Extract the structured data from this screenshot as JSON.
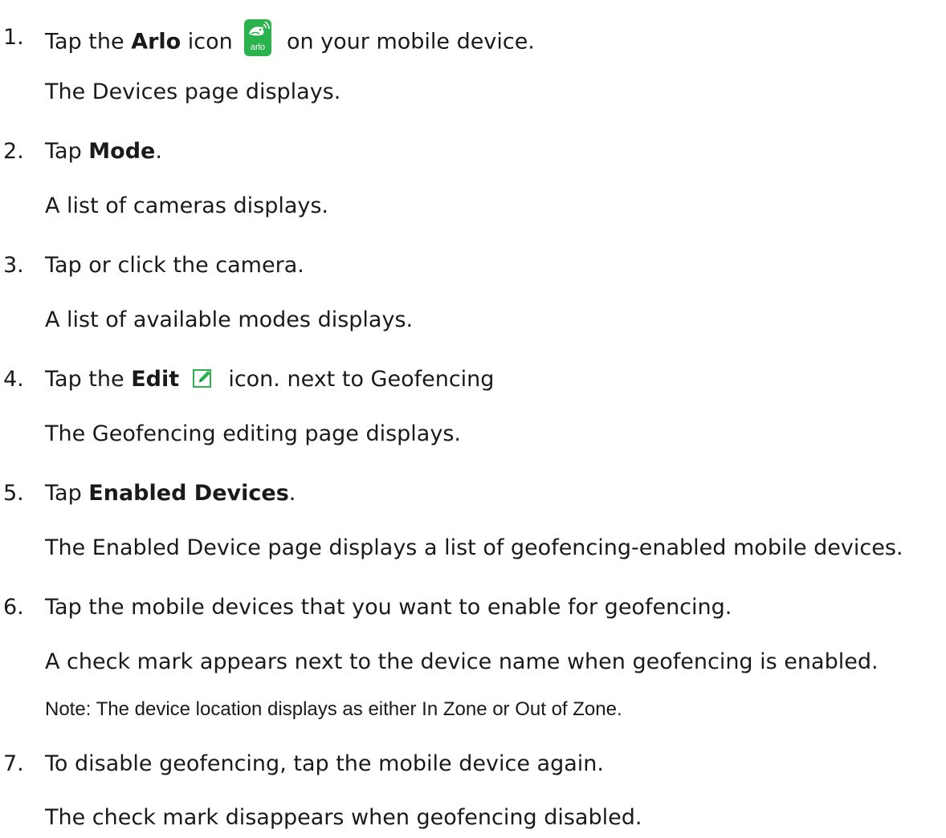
{
  "steps": [
    {
      "number": "1.",
      "pre": "Tap the ",
      "bold": "Arlo",
      "mid": " icon",
      "post": "on your mobile device.",
      "icon": "arlo-app-icon",
      "icon_text": "arlo",
      "icon_color": "#2bb24c",
      "detail": "The Devices page displays."
    },
    {
      "number": "2.",
      "pre": "Tap ",
      "bold": "Mode",
      "post": ".",
      "detail": "A list of cameras displays."
    },
    {
      "number": "3.",
      "text": "Tap or click the camera.",
      "detail": "A list of available modes displays."
    },
    {
      "number": "4.",
      "pre": "Tap the ",
      "bold": "Edit",
      "post": "icon. next to Geofencing",
      "icon": "edit-pencil-icon",
      "icon_color": "#2bb24c",
      "detail": "The Geofencing editing page displays."
    },
    {
      "number": "5.",
      "pre": "Tap ",
      "bold": "Enabled Devices",
      "post": ".",
      "detail": "The Enabled Device page displays a list of geofencing-enabled mobile devices."
    },
    {
      "number": "6.",
      "text": "Tap the mobile devices that you want to enable for geofencing.",
      "detail": "A check mark appears next to the device name when geofencing is enabled.",
      "note": "Note: The device location displays as either In Zone or Out of Zone."
    },
    {
      "number": "7.",
      "text": "To disable geofencing, tap the mobile device again.",
      "detail": "The check mark disappears when geofencing disabled."
    }
  ]
}
